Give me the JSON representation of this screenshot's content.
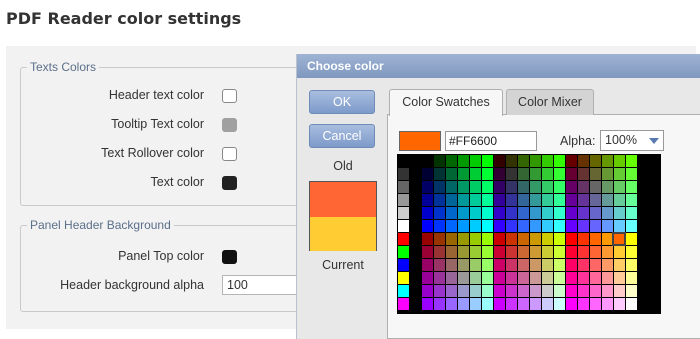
{
  "page": {
    "title": "PDF Reader color settings"
  },
  "texts_colors": {
    "legend": "Texts Colors",
    "items": [
      {
        "label": "Header text color",
        "color": "#ffffff"
      },
      {
        "label": "Tooltip Text color",
        "color": "#a0a0a0"
      },
      {
        "label": "Text Rollover color",
        "color": "#ffffff"
      },
      {
        "label": "Text color",
        "color": "#222222"
      }
    ]
  },
  "panel_header": {
    "legend": "Panel Header Background",
    "top_color_label": "Panel Top color",
    "top_color": "#111111",
    "alpha_label": "Header background alpha",
    "alpha_value": "100"
  },
  "dialog": {
    "title": "Choose color",
    "ok_label": "OK",
    "cancel_label": "Cancel",
    "old_label": "Old",
    "current_label": "Current",
    "new_color": "#ff6633",
    "old_color": "#ffcc33",
    "tabs": [
      "Color Swatches",
      "Color Mixer"
    ],
    "active_tab": "Color Swatches",
    "hex_value": "#FF6600",
    "alpha_label": "Alpha:",
    "alpha_value": "100%"
  }
}
